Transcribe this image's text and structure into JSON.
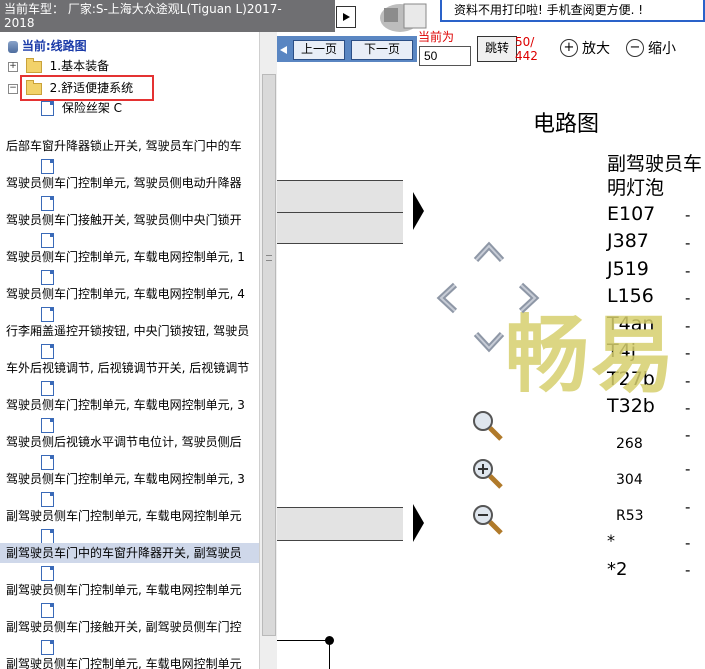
{
  "vehicle_bar": {
    "text": "当前车型： 厂家:S-上海大众途观L(Tiguan L)2017-2018"
  },
  "tree": {
    "root_label": "当前:线路图",
    "nodes": [
      {
        "label": "1.基本装备",
        "kind": "folder-collapsed"
      },
      {
        "label": "2.舒适便捷系统",
        "kind": "folder-open"
      },
      {
        "label": "保险丝架 C",
        "kind": "page"
      },
      {
        "label": "后部车窗升降器锁止开关, 驾驶员车门中的车",
        "kind": "text"
      },
      {
        "label": "驾驶员侧车门控制单元, 驾驶员侧电动升降器",
        "kind": "text"
      },
      {
        "label": "驾驶员侧车门接触开关, 驾驶员侧中央门锁开",
        "kind": "text"
      },
      {
        "label": "驾驶员侧车门控制单元, 车载电网控制单元, 1",
        "kind": "text"
      },
      {
        "label": "驾驶员侧车门控制单元, 车载电网控制单元, 4",
        "kind": "text"
      },
      {
        "label": "行李厢盖遥控开锁按钮, 中央门锁按钮, 驾驶员",
        "kind": "text"
      },
      {
        "label": "车外后视镜调节, 后视镜调节开关, 后视镜调节",
        "kind": "text"
      },
      {
        "label": "驾驶员侧车门控制单元, 车载电网控制单元, 3",
        "kind": "text"
      },
      {
        "label": "驾驶员侧后视镜水平调节电位计, 驾驶员侧后",
        "kind": "text"
      },
      {
        "label": "驾驶员侧车门控制单元, 车载电网控制单元, 3",
        "kind": "text"
      },
      {
        "label": "副驾驶员侧车门控制单元, 车载电网控制单元",
        "kind": "text"
      },
      {
        "label": "副驾驶员车门中的车窗升降器开关, 副驾驶员",
        "kind": "text",
        "selected": true
      },
      {
        "label": "副驾驶员侧车门控制单元, 车载电网控制单元",
        "kind": "text"
      },
      {
        "label": "副驾驶员侧车门接触开关, 副驾驶员侧车门控",
        "kind": "text"
      },
      {
        "label": "副驾驶员侧车门控制单元, 车载电网控制单元",
        "kind": "text"
      }
    ]
  },
  "banner": {
    "text": "资料不用打印啦! 手机查阅更方便. !"
  },
  "pager": {
    "prev_label": "上一页",
    "next_label": "下一页",
    "current_label": "当前为",
    "page_value": "50",
    "jump_label": "跳转",
    "total_top": "50/",
    "total_bottom": "442",
    "zoom_in_label": "放大",
    "zoom_out_label": "缩小"
  },
  "diagram": {
    "title": "电路图",
    "header_line1": "副驾驶员车",
    "header_line2": "明灯泡",
    "codes": [
      "E107",
      "J387",
      "J519",
      "L156",
      "T4an",
      "T4j",
      "T27b",
      "T32b"
    ],
    "small_codes": [
      "268",
      "304",
      "R53",
      "*",
      "*2"
    ],
    "dash": "-",
    "watermark": "畅易"
  },
  "colors": {
    "accent": "#2a62c9",
    "highlight_box": "#e43232",
    "watermark": "#d6cf6e"
  }
}
